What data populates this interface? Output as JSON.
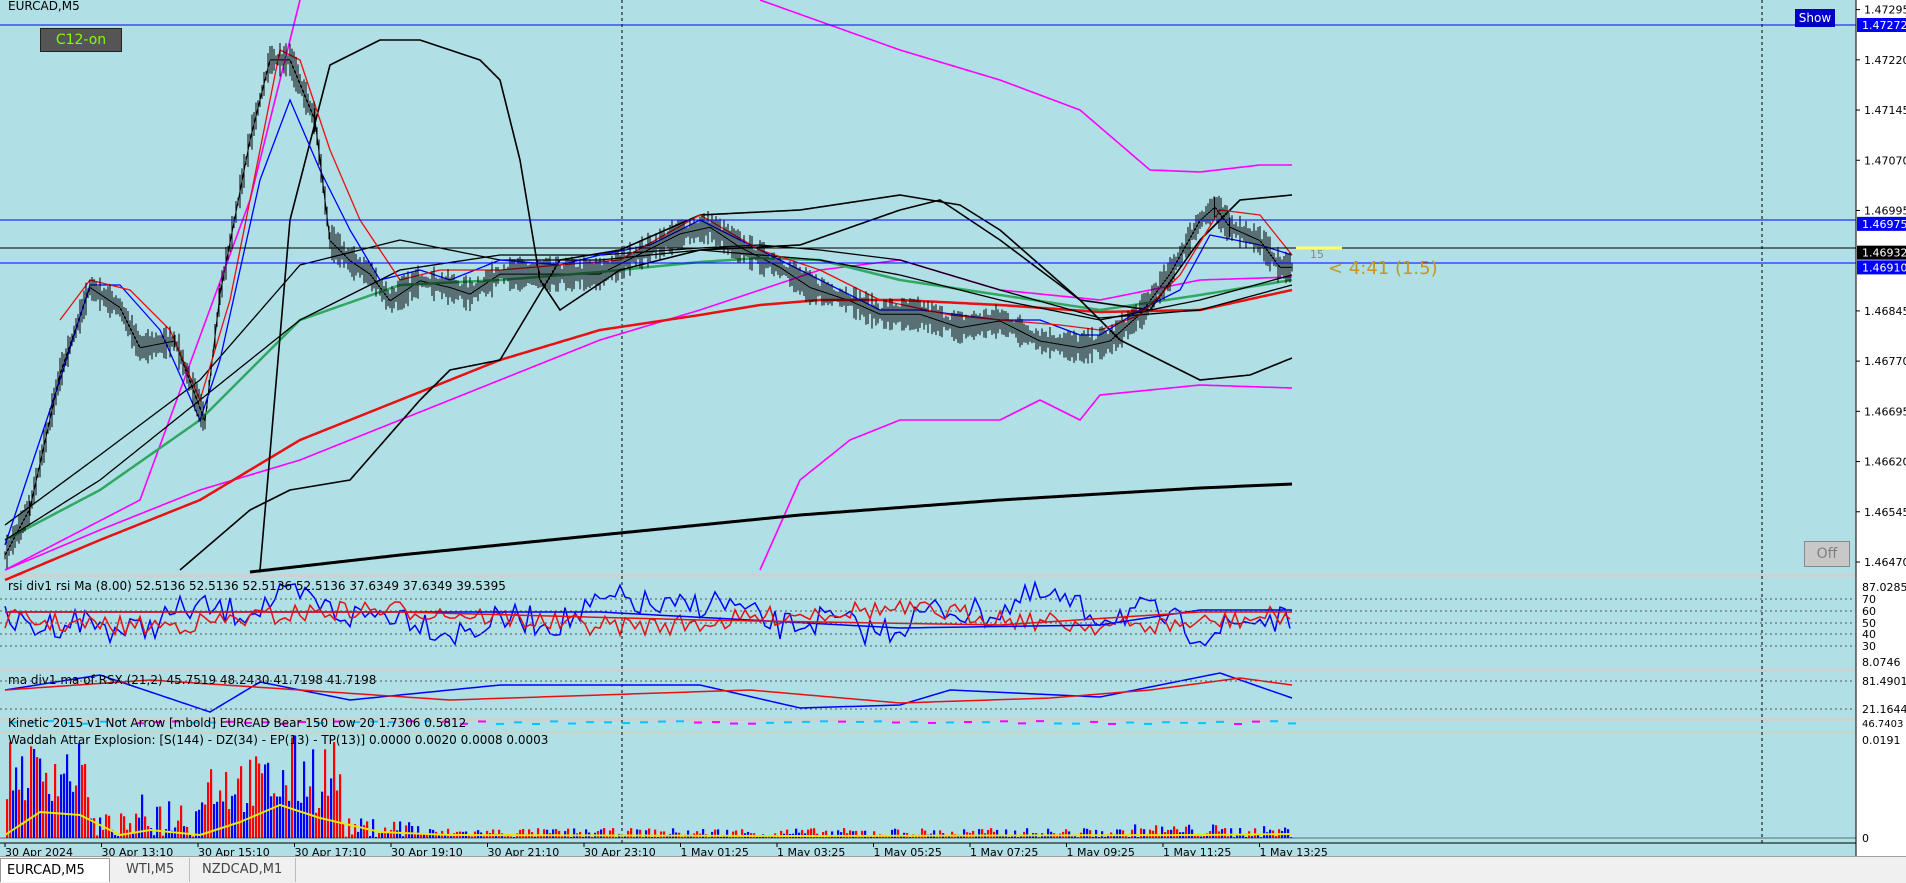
{
  "window": {
    "symbol_title": "EURCAD,M5"
  },
  "buttons": {
    "c12": "C12-on",
    "show": "Show",
    "off": "Off"
  },
  "timer_label": "< 4:41 (1.5)",
  "spread_label": "15",
  "price_axis": {
    "ticks": [
      "1.47295",
      "1.47220",
      "1.47145",
      "1.47070",
      "1.46995",
      "1.46845",
      "1.46770",
      "1.46695",
      "1.46620",
      "1.46545",
      "1.46470"
    ],
    "markers": [
      {
        "label": "1.47272",
        "color": "#0000ff"
      },
      {
        "label": "1.46975",
        "color": "#0000ff"
      },
      {
        "label": "1.46932",
        "color": "#000000"
      },
      {
        "label": "1.46910",
        "color": "#0000ff"
      }
    ]
  },
  "time_axis": [
    "30 Apr 2024",
    "30 Apr 13:10",
    "30 Apr 15:10",
    "30 Apr 17:10",
    "30 Apr 19:10",
    "30 Apr 21:10",
    "30 Apr 23:10",
    "1 May 01:25",
    "1 May 03:25",
    "1 May 05:25",
    "1 May 07:25",
    "1 May 09:25",
    "1 May 11:25",
    "1 May 13:25"
  ],
  "rsi_panel": {
    "title": "rsi div1 rsi Ma (8.00) 52.5136 52.5136 52.5136 52.5136 37.6349 37.6349 39.5395",
    "levels": [
      "87.0285",
      "70",
      "60",
      "50",
      "40",
      "30",
      "8.0746"
    ]
  },
  "ma_panel": {
    "title": "ma div1 ma of RSX (21,2) 45.7519 48.2430 41.7198 41.7198",
    "levels": [
      "81.4901",
      "21.1644"
    ]
  },
  "kinetic_panel": {
    "title": "Kinetic 2015 v1 Not Arrow [mbold] EURCAD Bear 150 Low 20 1.7306 0.5812",
    "levels": [
      "46.7403"
    ]
  },
  "waddah_panel": {
    "title": "Waddah Attar Explosion: [S(144) - DZ(34) - EP(13) - TP(13)] 0.0000 0.0020 0.0008 0.0003",
    "levels": [
      "0.0191",
      "0"
    ]
  },
  "tabs": [
    "EURCAD,M5",
    "WTI,M5",
    "NZDCAD,M1"
  ],
  "colors": {
    "background": "#b0dfe6",
    "bull": "#ff0000",
    "bear": "#0000ff",
    "ma_red": "#e81010",
    "ma_green": "#30a860",
    "band_magenta": "#ff00ff",
    "timer": "#c8961e"
  },
  "chart_data": {
    "type": "line",
    "title": "EURCAD,M5",
    "ylim": [
      1.4647,
      1.473
    ],
    "x": [
      "30 Apr 2024",
      "30 Apr 13:10",
      "30 Apr 15:10",
      "30 Apr 17:10",
      "30 Apr 19:10",
      "30 Apr 21:10",
      "30 Apr 23:10",
      "1 May 01:25",
      "1 May 03:25",
      "1 May 05:25",
      "1 May 07:25",
      "1 May 09:25",
      "1 May 11:25",
      "1 May 13:25"
    ],
    "series": [
      {
        "values": [
          1.4648,
          1.4687,
          1.4718,
          1.469,
          1.4687,
          1.469,
          1.469,
          1.4697,
          1.4687,
          1.4683,
          1.4681,
          1.468,
          1.4698,
          1.4691
        ]
      }
    ]
  }
}
